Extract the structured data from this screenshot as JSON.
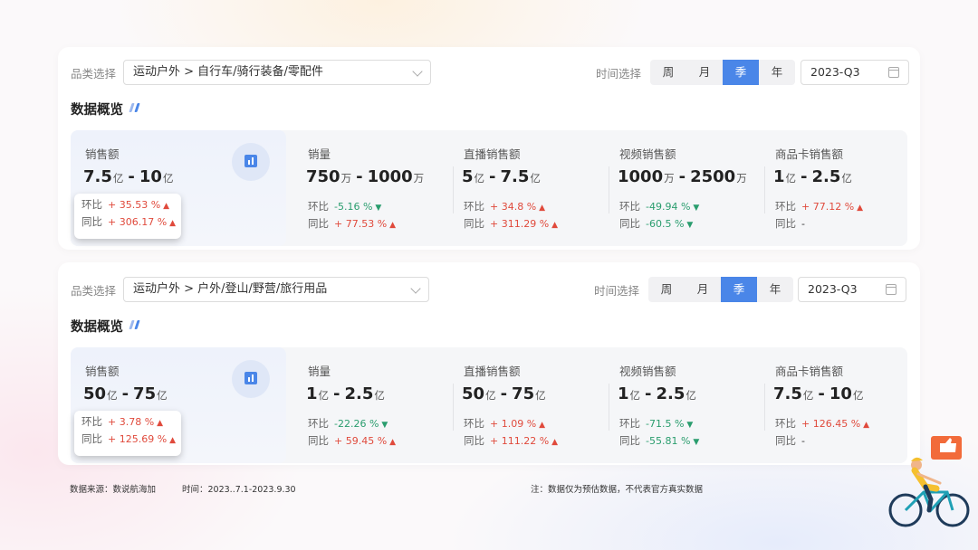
{
  "panels": [
    {
      "category_label": "品类选择",
      "category_value": "运动户外 > 自行车/骑行装备/零配件",
      "time_label": "时间选择",
      "time_options": [
        "周",
        "月",
        "季",
        "年"
      ],
      "time_selected": "季",
      "date_value": "2023-Q3",
      "section_title": "数据概览",
      "sales": {
        "label": "销售额",
        "low": "7.5",
        "low_unit": "亿",
        "dash": "-",
        "high": "10",
        "high_unit": "亿",
        "mom_label": "环比",
        "mom_value": "+ 35.53 %",
        "mom_dir": "up",
        "yoy_label": "同比",
        "yoy_value": "+ 306.17 %",
        "yoy_dir": "up"
      },
      "metrics": [
        {
          "label": "销量",
          "low": "750",
          "low_unit": "万",
          "high": "1000",
          "high_unit": "万",
          "mom_label": "环比",
          "mom_value": "-5.16 %",
          "mom_dir": "down",
          "yoy_label": "同比",
          "yoy_value": "+ 77.53 %",
          "yoy_dir": "up"
        },
        {
          "label": "直播销售额",
          "low": "5",
          "low_unit": "亿",
          "high": "7.5",
          "high_unit": "亿",
          "mom_label": "环比",
          "mom_value": "+ 34.8 %",
          "mom_dir": "up",
          "yoy_label": "同比",
          "yoy_value": "+ 311.29 %",
          "yoy_dir": "up"
        },
        {
          "label": "视频销售额",
          "low": "1000",
          "low_unit": "万",
          "high": "2500",
          "high_unit": "万",
          "mom_label": "环比",
          "mom_value": "-49.94 %",
          "mom_dir": "down",
          "yoy_label": "同比",
          "yoy_value": "-60.5 %",
          "yoy_dir": "down"
        },
        {
          "label": "商品卡销售额",
          "low": "1",
          "low_unit": "亿",
          "high": "2.5",
          "high_unit": "亿",
          "mom_label": "环比",
          "mom_value": "+ 77.12 %",
          "mom_dir": "up",
          "yoy_label": "同比",
          "yoy_value": "-",
          "yoy_dir": "none"
        }
      ]
    },
    {
      "category_label": "品类选择",
      "category_value": "运动户外 > 户外/登山/野营/旅行用品",
      "time_label": "时间选择",
      "time_options": [
        "周",
        "月",
        "季",
        "年"
      ],
      "time_selected": "季",
      "date_value": "2023-Q3",
      "section_title": "数据概览",
      "sales": {
        "label": "销售额",
        "low": "50",
        "low_unit": "亿",
        "dash": "-",
        "high": "75",
        "high_unit": "亿",
        "mom_label": "环比",
        "mom_value": "+ 3.78 %",
        "mom_dir": "up",
        "yoy_label": "同比",
        "yoy_value": "+ 125.69 %",
        "yoy_dir": "up"
      },
      "metrics": [
        {
          "label": "销量",
          "low": "1",
          "low_unit": "亿",
          "high": "2.5",
          "high_unit": "亿",
          "mom_label": "环比",
          "mom_value": "-22.26 %",
          "mom_dir": "down",
          "yoy_label": "同比",
          "yoy_value": "+ 59.45 %",
          "yoy_dir": "up"
        },
        {
          "label": "直播销售额",
          "low": "50",
          "low_unit": "亿",
          "high": "75",
          "high_unit": "亿",
          "mom_label": "环比",
          "mom_value": "+ 1.09 %",
          "mom_dir": "up",
          "yoy_label": "同比",
          "yoy_value": "+ 111.22 %",
          "yoy_dir": "up"
        },
        {
          "label": "视频销售额",
          "low": "1",
          "low_unit": "亿",
          "high": "2.5",
          "high_unit": "亿",
          "mom_label": "环比",
          "mom_value": "-71.5 %",
          "mom_dir": "down",
          "yoy_label": "同比",
          "yoy_value": "-55.81 %",
          "yoy_dir": "down"
        },
        {
          "label": "商品卡销售额",
          "low": "7.5",
          "low_unit": "亿",
          "high": "10",
          "high_unit": "亿",
          "mom_label": "环比",
          "mom_value": "+ 126.45 %",
          "mom_dir": "up",
          "yoy_label": "同比",
          "yoy_value": "-",
          "yoy_dir": "none"
        }
      ]
    }
  ],
  "footer": {
    "source": "数据来源：数说航海加",
    "time": "时间：2023..7.1-2023.9.30",
    "note": "注：数据仅为预估数据，不代表官方真实数据"
  },
  "colors": {
    "accent": "#4a86e8",
    "up": "#e04a3c",
    "down": "#2a9d6e"
  },
  "icons": [
    "bar-chart-icon",
    "calendar-icon",
    "chevron-down-icon",
    "thumbs-up-icon"
  ]
}
